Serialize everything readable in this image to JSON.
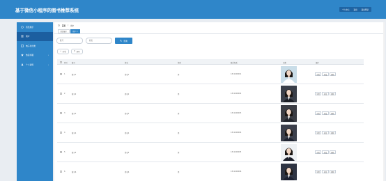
{
  "header": {
    "title": "基于微信小程序的图书推荐系统",
    "actions": [
      "个人中心",
      "退出",
      "退出登录"
    ]
  },
  "sidebar": {
    "items": [
      {
        "label": "首页展示",
        "icon": "home-icon",
        "arrow": ""
      },
      {
        "label": "用户",
        "icon": "list-icon",
        "arrow": ""
      },
      {
        "label": "电子书分类",
        "icon": "book-icon",
        "arrow": ""
      },
      {
        "label": "热读书籍",
        "icon": "star-icon",
        "arrow": "›"
      },
      {
        "label": "个人资料",
        "icon": "user-icon",
        "arrow": "›"
      }
    ]
  },
  "breadcrumb": {
    "home": "首页",
    "separator": "/",
    "current": "用户"
  },
  "tabs": [
    {
      "label": "首页展示",
      "active": false
    },
    {
      "label": "用户 ×",
      "active": true
    }
  ],
  "search": {
    "fields": [
      {
        "placeholder": "账号"
      },
      {
        "placeholder": "姓名"
      }
    ],
    "button_label": "查询"
  },
  "actions": {
    "add_label": "新增",
    "delete_label": "删除"
  },
  "table": {
    "columns": [
      "索引",
      "账号",
      "姓名",
      "性别",
      "联系电话",
      "头像",
      "操作"
    ],
    "rows": [
      {
        "index": "1",
        "account": "账号1",
        "name": "姓名1",
        "gender": "男",
        "phone": "1311100001"
      },
      {
        "index": "2",
        "account": "账号2",
        "name": "姓名2",
        "gender": "男",
        "phone": "1311100002"
      },
      {
        "index": "3",
        "account": "账号3",
        "name": "姓名3",
        "gender": "男",
        "phone": "1311100003"
      },
      {
        "index": "4",
        "account": "账号4",
        "name": "姓名4",
        "gender": "男",
        "phone": "1311100004"
      },
      {
        "index": "5",
        "account": "账号5",
        "name": "姓名5",
        "gender": "男",
        "phone": "1311100005"
      },
      {
        "index": "6",
        "account": "账号6",
        "name": "姓名6",
        "gender": "男",
        "phone": "1311100006"
      }
    ],
    "row_actions": [
      "详情",
      "修改",
      "删除"
    ]
  },
  "colors": {
    "primary": "#2f86c9",
    "sidebar_active": "#1c5fa0",
    "background": "#e9edf2"
  }
}
